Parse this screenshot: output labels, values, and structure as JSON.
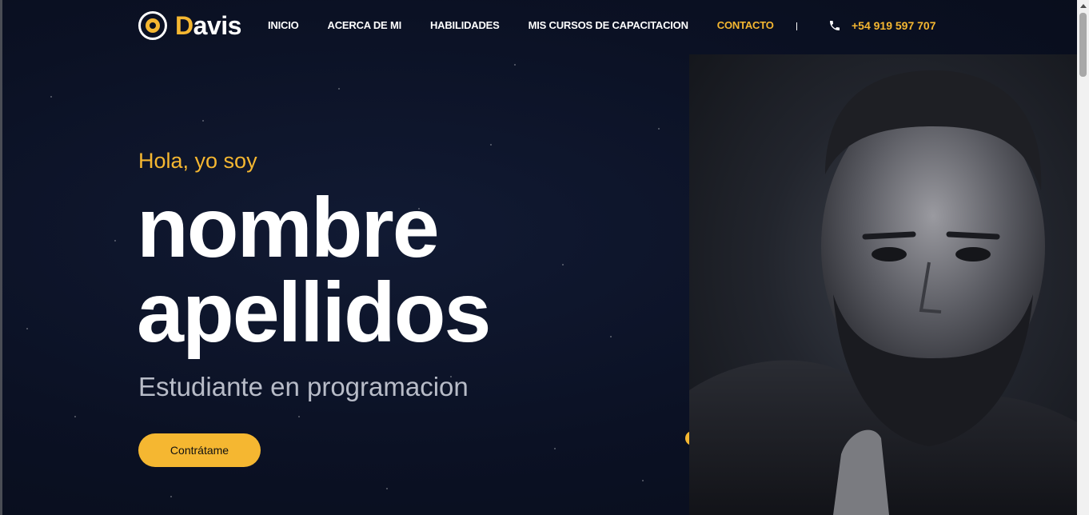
{
  "logo": {
    "first_letter": "D",
    "rest": "avis"
  },
  "nav": {
    "items": [
      {
        "label": "INICIO",
        "active": false
      },
      {
        "label": "ACERCA DE MI",
        "active": false
      },
      {
        "label": "HABILIDADES",
        "active": false
      },
      {
        "label": "MIS CURSOS DE CAPACITACION",
        "active": false
      },
      {
        "label": "CONTACTO",
        "active": true
      }
    ],
    "phone": "+54 919 597 707"
  },
  "hero": {
    "greeting": "Hola, yo soy",
    "name_line1": "nombre",
    "name_line2": "apellidos",
    "role": "Estudiante en programacion",
    "cta_label": "Contrátame"
  },
  "colors": {
    "accent": "#f5b731",
    "background": "#0b1020",
    "text": "#ffffff",
    "muted": "#b8bcc8"
  },
  "icons": {
    "logo": "flower-circle-icon",
    "phone": "phone-icon"
  }
}
